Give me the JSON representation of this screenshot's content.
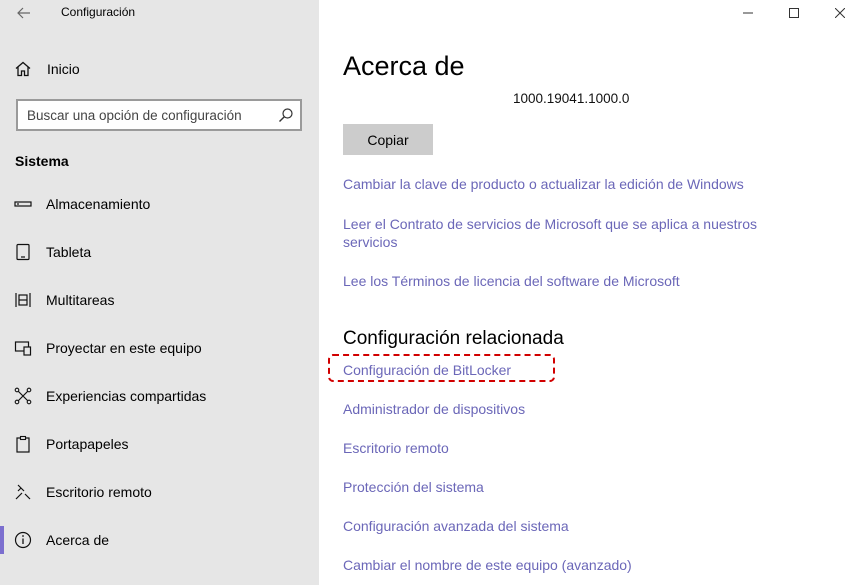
{
  "window": {
    "title": "Configuración"
  },
  "sidebar": {
    "home_label": "Inicio",
    "search_placeholder": "Buscar una opción de configuración",
    "section_title": "Sistema",
    "items": [
      {
        "label": "Almacenamiento",
        "icon": "storage-icon"
      },
      {
        "label": "Tableta",
        "icon": "tablet-icon"
      },
      {
        "label": "Multitareas",
        "icon": "multitasking-icon"
      },
      {
        "label": "Proyectar en este equipo",
        "icon": "projecting-icon"
      },
      {
        "label": "Experiencias compartidas",
        "icon": "shared-experiences-icon"
      },
      {
        "label": "Portapapeles",
        "icon": "clipboard-icon"
      },
      {
        "label": "Escritorio remoto",
        "icon": "remote-desktop-icon"
      },
      {
        "label": "Acerca de",
        "icon": "info-icon",
        "active": true
      }
    ]
  },
  "main": {
    "title": "Acerca de",
    "version": "1000.19041.1000.0",
    "copy_label": "Copiar",
    "links": [
      "Cambiar la clave de producto o actualizar la edición de Windows",
      "Leer el Contrato de servicios de Microsoft que se aplica a nuestros servicios",
      "Lee los Términos de licencia del software de Microsoft"
    ],
    "related_title": "Configuración relacionada",
    "related_links": [
      "Configuración de BitLocker",
      "Administrador de dispositivos",
      "Escritorio remoto",
      "Protección del sistema",
      "Configuración avanzada del sistema",
      "Cambiar el nombre de este equipo (avanzado)"
    ]
  },
  "colors": {
    "accent": "#6b67b8",
    "sidebar_bg": "#e6e6e6",
    "highlight": "#d10000",
    "active_indicator": "#7c6fcf"
  }
}
